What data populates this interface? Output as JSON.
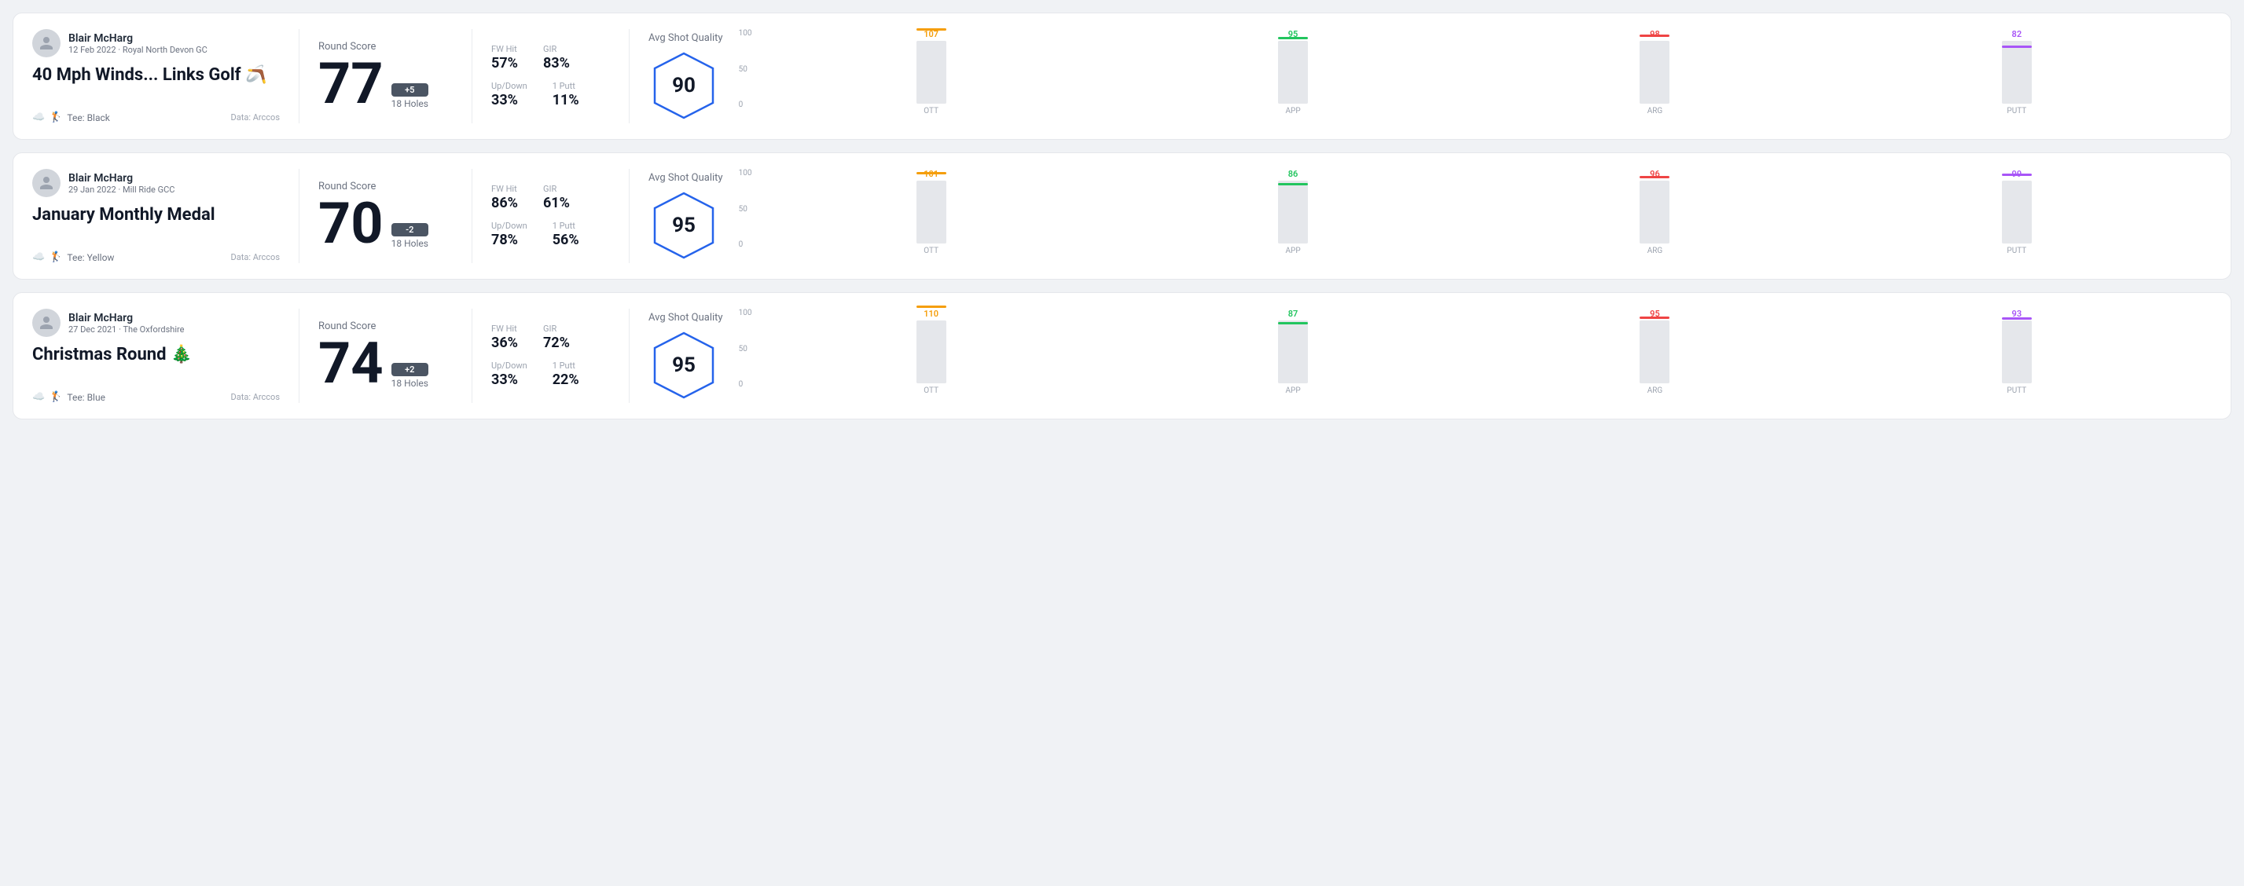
{
  "rounds": [
    {
      "id": "round1",
      "user": {
        "name": "Blair McHarg",
        "date": "12 Feb 2022",
        "course": "Royal North Devon GC"
      },
      "title": "40 Mph Winds... Links Golf 🪃",
      "tee": "Black",
      "data_source": "Data: Arccos",
      "score": {
        "label": "Round Score",
        "number": "77",
        "badge": "+5",
        "holes": "18 Holes"
      },
      "stats": {
        "fw_hit_label": "FW Hit",
        "fw_hit_value": "57%",
        "gir_label": "GIR",
        "gir_value": "83%",
        "updown_label": "Up/Down",
        "updown_value": "33%",
        "oneputt_label": "1 Putt",
        "oneputt_value": "11%"
      },
      "quality": {
        "label": "Avg Shot Quality",
        "score": "90",
        "chart": {
          "bars": [
            {
              "label": "OTT",
              "value": 107,
              "color": "#f59e0b",
              "max": 110
            },
            {
              "label": "APP",
              "value": 95,
              "color": "#22c55e",
              "max": 110
            },
            {
              "label": "ARG",
              "value": 98,
              "color": "#ef4444",
              "max": 110
            },
            {
              "label": "PUTT",
              "value": 82,
              "color": "#a855f7",
              "max": 110
            }
          ],
          "y_labels": [
            "100",
            "50",
            "0"
          ]
        }
      }
    },
    {
      "id": "round2",
      "user": {
        "name": "Blair McHarg",
        "date": "29 Jan 2022",
        "course": "Mill Ride GCC"
      },
      "title": "January Monthly Medal",
      "tee": "Yellow",
      "data_source": "Data: Arccos",
      "score": {
        "label": "Round Score",
        "number": "70",
        "badge": "-2",
        "holes": "18 Holes"
      },
      "stats": {
        "fw_hit_label": "FW Hit",
        "fw_hit_value": "86%",
        "gir_label": "GIR",
        "gir_value": "61%",
        "updown_label": "Up/Down",
        "updown_value": "78%",
        "oneputt_label": "1 Putt",
        "oneputt_value": "56%"
      },
      "quality": {
        "label": "Avg Shot Quality",
        "score": "95",
        "chart": {
          "bars": [
            {
              "label": "OTT",
              "value": 101,
              "color": "#f59e0b",
              "max": 110
            },
            {
              "label": "APP",
              "value": 86,
              "color": "#22c55e",
              "max": 110
            },
            {
              "label": "ARG",
              "value": 96,
              "color": "#ef4444",
              "max": 110
            },
            {
              "label": "PUTT",
              "value": 99,
              "color": "#a855f7",
              "max": 110
            }
          ],
          "y_labels": [
            "100",
            "50",
            "0"
          ]
        }
      }
    },
    {
      "id": "round3",
      "user": {
        "name": "Blair McHarg",
        "date": "27 Dec 2021",
        "course": "The Oxfordshire"
      },
      "title": "Christmas Round 🎄",
      "tee": "Blue",
      "data_source": "Data: Arccos",
      "score": {
        "label": "Round Score",
        "number": "74",
        "badge": "+2",
        "holes": "18 Holes"
      },
      "stats": {
        "fw_hit_label": "FW Hit",
        "fw_hit_value": "36%",
        "gir_label": "GIR",
        "gir_value": "72%",
        "updown_label": "Up/Down",
        "updown_value": "33%",
        "oneputt_label": "1 Putt",
        "oneputt_value": "22%"
      },
      "quality": {
        "label": "Avg Shot Quality",
        "score": "95",
        "chart": {
          "bars": [
            {
              "label": "OTT",
              "value": 110,
              "color": "#f59e0b",
              "max": 115
            },
            {
              "label": "APP",
              "value": 87,
              "color": "#22c55e",
              "max": 115
            },
            {
              "label": "ARG",
              "value": 95,
              "color": "#ef4444",
              "max": 115
            },
            {
              "label": "PUTT",
              "value": 93,
              "color": "#a855f7",
              "max": 115
            }
          ],
          "y_labels": [
            "100",
            "50",
            "0"
          ]
        }
      }
    }
  ]
}
